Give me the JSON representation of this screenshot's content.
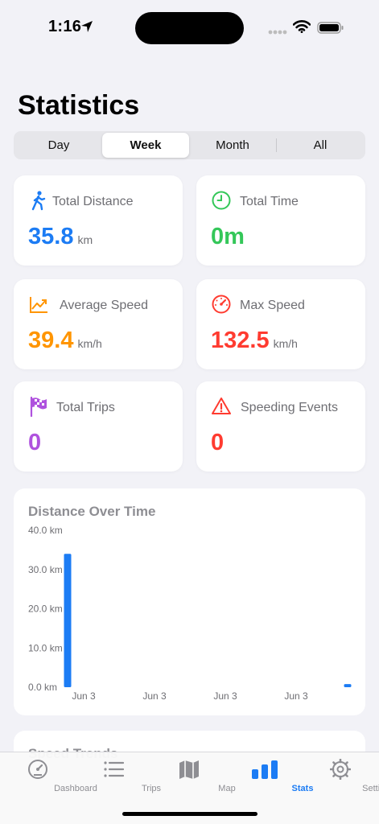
{
  "status": {
    "time": "1:16"
  },
  "title": "Statistics",
  "segments": [
    "Day",
    "Week",
    "Month",
    "All"
  ],
  "selected_segment": "Week",
  "cards": {
    "distance": {
      "label": "Total Distance",
      "value": "35.8",
      "unit": "km",
      "color": "#1c7cf4",
      "icon": "walking-figure-icon"
    },
    "time": {
      "label": "Total Time",
      "value": "0m",
      "unit": "",
      "color": "#34c759",
      "icon": "clock-icon"
    },
    "avg_speed": {
      "label": "Average Speed",
      "value": "39.4",
      "unit": "km/h",
      "color": "#ff9500",
      "icon": "trend-chart-icon"
    },
    "max_speed": {
      "label": "Max Speed",
      "value": "132.5",
      "unit": "km/h",
      "color": "#ff3b30",
      "icon": "speedometer-icon"
    },
    "trips": {
      "label": "Total Trips",
      "value": "0",
      "unit": "",
      "color": "#af52de",
      "icon": "checkered-flag-icon"
    },
    "speeding": {
      "label": "Speeding Events",
      "value": "0",
      "unit": "",
      "color": "#ff3b30",
      "icon": "warning-triangle-icon"
    }
  },
  "chart": {
    "title": "Distance Over Time"
  },
  "chart_data": {
    "type": "bar",
    "title": "Distance Over Time",
    "x": [
      "Jun 3",
      "Jun 3",
      "Jun 3",
      "Jun 3",
      ""
    ],
    "x_ticks": [
      "Jun 3",
      "Jun 3",
      "Jun 3",
      "Jun 3"
    ],
    "values": [
      34.0,
      0,
      0,
      0,
      0.8
    ],
    "y_ticks": [
      "0.0 km",
      "10.0 km",
      "20.0 km",
      "30.0 km",
      "40.0 km"
    ],
    "ylim": [
      0,
      40
    ],
    "bar_color": "#1c7cf4",
    "grid": false
  },
  "next_section": {
    "title": "Speed Trends"
  },
  "tabs": [
    {
      "label": "Dashboard",
      "icon": "gauge-icon"
    },
    {
      "label": "Trips",
      "icon": "list-icon"
    },
    {
      "label": "Map",
      "icon": "map-icon"
    },
    {
      "label": "Stats",
      "icon": "bar-chart-icon"
    },
    {
      "label": "Settings",
      "icon": "gear-icon"
    }
  ],
  "active_tab": "Stats"
}
